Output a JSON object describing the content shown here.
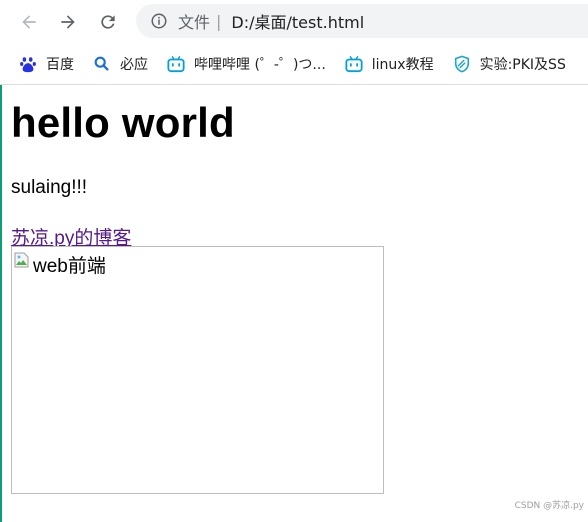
{
  "browser": {
    "address": {
      "scheme_label": "文件",
      "separator": "|",
      "url": "D:/桌面/test.html"
    }
  },
  "bookmarks": [
    {
      "label": "百度",
      "icon": "baidu-paw-icon"
    },
    {
      "label": "必应",
      "icon": "bing-search-icon"
    },
    {
      "label": "哔哩哔哩 (゜-゜)つ...",
      "icon": "bilibili-tv-icon"
    },
    {
      "label": "linux教程",
      "icon": "bilibili-tv-icon"
    },
    {
      "label": "实验:PKI及SS",
      "icon": "shield-icon"
    }
  ],
  "page": {
    "heading": "hello world",
    "paragraph": "sulaing!!!",
    "link_text": "苏凉.py的博客",
    "image_alt": "web前端"
  },
  "watermark": "CSDN @苏凉.py",
  "colors": {
    "left_accent": "#0f9d76",
    "visited_link": "#551a8b",
    "address_bg": "#f1f3f4",
    "bilibili_blue": "#00a1d6",
    "baidu_blue": "#2932e1",
    "bing_blue": "#1e6fd9",
    "shield_teal": "#1ea7c8"
  }
}
